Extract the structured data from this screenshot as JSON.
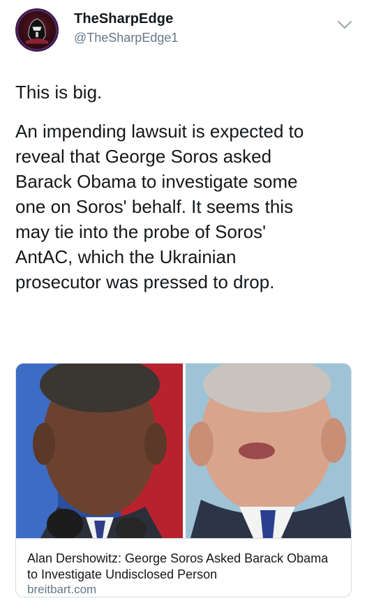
{
  "author": {
    "display_name": "TheSharpEdge",
    "handle": "@TheSharpEdge1",
    "avatar_icon": "dark-helmet-avatar-icon"
  },
  "menu_icon": "chevron-down-icon",
  "tweet": {
    "line1": "This is big.",
    "body_lines": [
      "An impending lawsuit is expected to",
      "reveal that George Soros asked",
      "Barack Obama to investigate some",
      "one on Soros' behalf.  It seems this",
      "may tie into the probe of Soros'",
      "AntAC, which the Ukrainian",
      "prosecutor was pressed to drop."
    ]
  },
  "link_card": {
    "title": "Alan Dershowitz: George Soros Asked Barack Obama to Investigate Undisclosed Person",
    "domain": "breitbart.com"
  },
  "colors": {
    "text": "#14171a",
    "secondary": "#657786",
    "border": "#d5dbe0"
  }
}
